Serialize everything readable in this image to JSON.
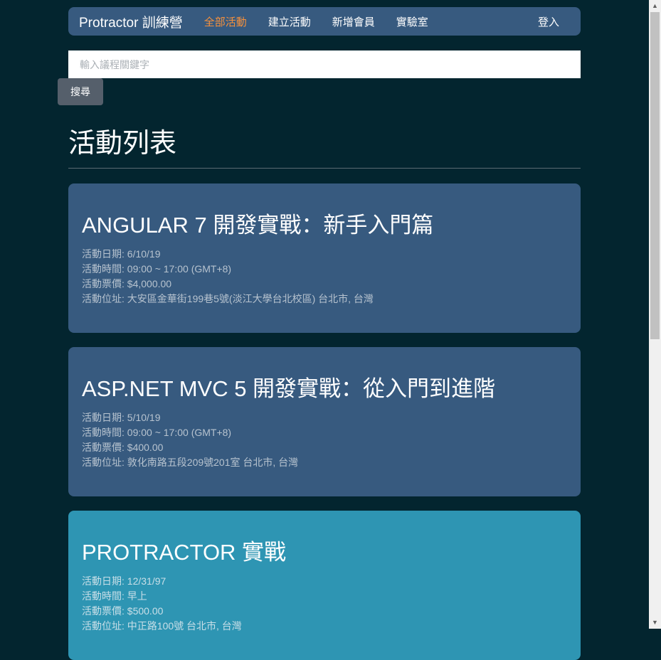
{
  "navbar": {
    "brand": "Protractor 訓練營",
    "items": [
      {
        "label": "全部活動",
        "active": true
      },
      {
        "label": "建立活動",
        "active": false
      },
      {
        "label": "新增會員",
        "active": false
      },
      {
        "label": "實驗室",
        "active": false
      }
    ],
    "login": "登入"
  },
  "search": {
    "placeholder": "輸入議程關鍵字",
    "value": "",
    "button_label": "搜尋"
  },
  "page": {
    "title": "活動列表"
  },
  "events": [
    {
      "title": "ANGULAR 7 開發實戰：新手入門篇",
      "date": "活動日期: 6/10/19",
      "time": "活動時間: 09:00 ~ 17:00 (GMT+8)",
      "price": "活動票價: $4,000.00",
      "location": "活動位址: 大安區金華街199巷5號(淡江大學台北校區)   台北市, 台灣"
    },
    {
      "title": "ASP.NET MVC 5 開發實戰：從入門到進階",
      "date": "活動日期: 5/10/19",
      "time": "活動時間: 09:00 ~ 17:00 (GMT+8)",
      "price": "活動票價: $400.00",
      "location": "活動位址: 敦化南路五段209號201室   台北市, 台灣"
    },
    {
      "title": "PROTRACTOR 實戰",
      "date": "活動日期: 12/31/97",
      "time": "活動時間: 早上",
      "price": "活動票價: $500.00",
      "location": "活動位址: 中正路100號   台北市, 台灣"
    }
  ],
  "colors": {
    "background": "#03252f",
    "navbar": "#375a7f",
    "nav_active": "#f7913c",
    "card_primary": "#375a7f",
    "card_highlight": "#2e95b3"
  }
}
